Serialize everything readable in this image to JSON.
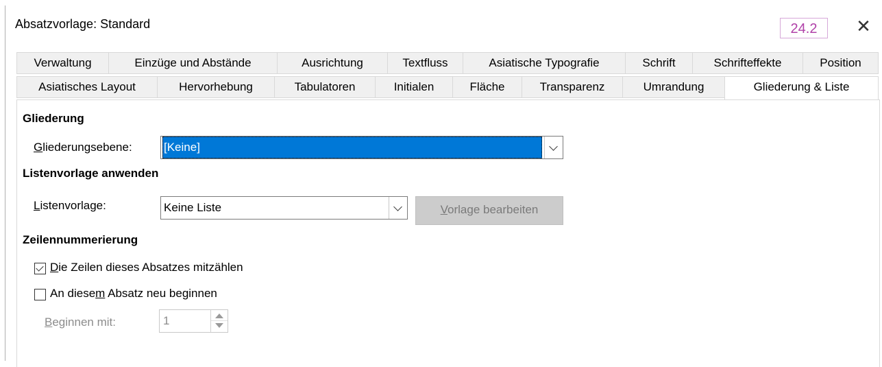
{
  "window": {
    "title": "Absatzvorlage: Standard",
    "version_badge": "24.2",
    "close_symbol": "✕"
  },
  "tabs_row1": [
    "Verwaltung",
    "Einzüge und Abstände",
    "Ausrichtung",
    "Textfluss",
    "Asiatische Typografie",
    "Schrift",
    "Schrifteffekte",
    "Position"
  ],
  "tabs_row2": [
    "Asiatisches Layout",
    "Hervorhebung",
    "Tabulatoren",
    "Initialen",
    "Fläche",
    "Transparenz",
    "Umrandung",
    "Gliederung & Liste"
  ],
  "active_tab": "Gliederung & Liste",
  "outline": {
    "heading": "Gliederung",
    "level_label_first": "G",
    "level_label_rest": "liederungsebene:",
    "level_value": "[Keine]"
  },
  "list_style": {
    "heading": "Listenvorlage anwenden",
    "label_first": "L",
    "label_rest": "istenvorlage:",
    "value": "Keine Liste",
    "edit_button_first": "V",
    "edit_button_rest": "orlage bearbeiten"
  },
  "line_numbering": {
    "heading": "Zeilennummerierung",
    "count_lines_first": "D",
    "count_lines_rest": "ie Zeilen dieses Absatzes mitzählen",
    "count_lines_checked": true,
    "restart_pre": "An diese",
    "restart_mn": "m",
    "restart_post": " Absatz neu beginnen",
    "restart_checked": false,
    "start_with_first": "B",
    "start_with_rest": "eginnen mit:",
    "start_with_value": "1"
  },
  "icons": {
    "close": "close-icon",
    "dropdown": "chevron-down-icon",
    "check": "checkmark-icon",
    "spin_up": "arrow-up-icon",
    "spin_down": "arrow-down-icon"
  }
}
